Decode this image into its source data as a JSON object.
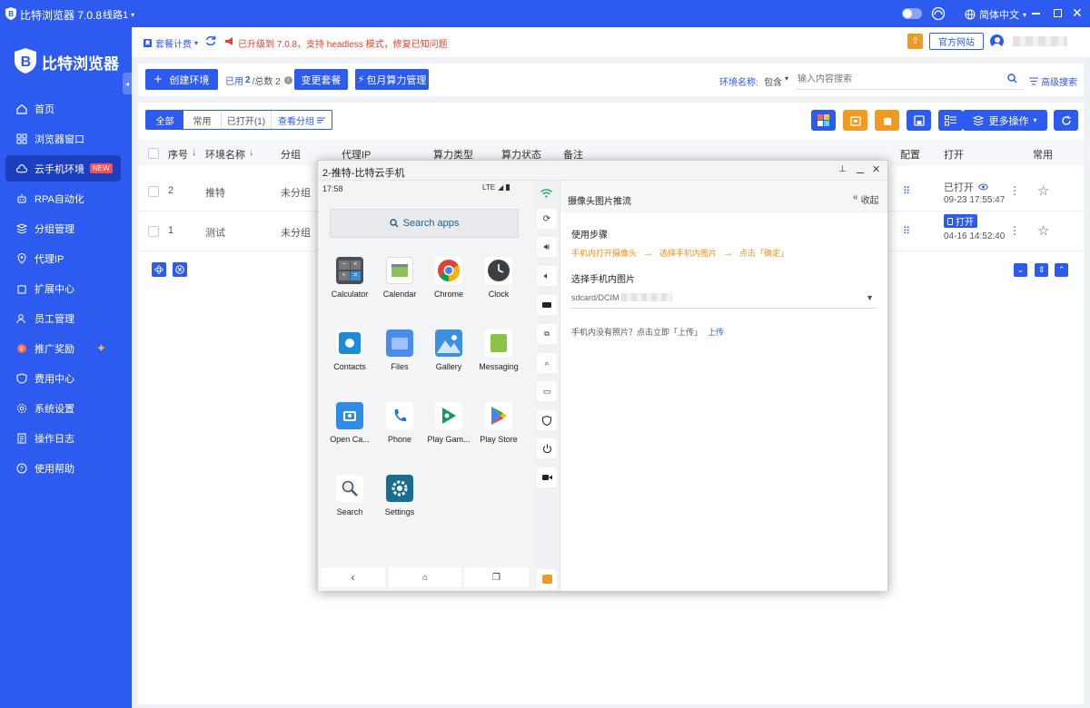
{
  "app": {
    "title": "比特浏览器 7.0.8",
    "route": "线路1",
    "language": "简体中文",
    "logo_text": "比特浏览器"
  },
  "sidebar": {
    "items": [
      {
        "label": "首页",
        "icon": "home-icon"
      },
      {
        "label": "浏览器窗口",
        "icon": "grid-icon"
      },
      {
        "label": "云手机环境",
        "icon": "cloud-icon",
        "badge": "NEW",
        "active": true
      },
      {
        "label": "RPA自动化",
        "icon": "robot-icon"
      },
      {
        "label": "分组管理",
        "icon": "group-icon"
      },
      {
        "label": "代理IP",
        "icon": "location-icon"
      },
      {
        "label": "扩展中心",
        "icon": "puzzle-icon"
      },
      {
        "label": "员工管理",
        "icon": "users-icon"
      },
      {
        "label": "推广奖励",
        "icon": "gift-icon"
      },
      {
        "label": "费用中心",
        "icon": "shield-icon"
      },
      {
        "label": "系统设置",
        "icon": "gear-icon"
      },
      {
        "label": "操作日志",
        "icon": "log-icon"
      },
      {
        "label": "使用帮助",
        "icon": "help-icon"
      }
    ]
  },
  "header": {
    "plan_label": "套餐计费",
    "notice": "已升级到 7.0.8，支持 headless 模式，修复已知问题",
    "website_button": "官方网站"
  },
  "toolbar": {
    "create_button": "创建环境",
    "usage_prefix": "已用",
    "usage_used": "2",
    "usage_total_label": "/总数 2",
    "change_plan_button": "变更套餐",
    "monthly_button": "包月算力管理",
    "env_name_label": "环境名称:",
    "match_select": "包含",
    "search_placeholder": "输入内容搜索",
    "advanced_search": "高级搜索"
  },
  "filters": {
    "tabs": [
      "全部",
      "常用",
      "已打开(1)",
      "查看分组"
    ],
    "more_ops": "更多操作"
  },
  "table": {
    "headers": [
      "序号",
      "环境名称",
      "分组",
      "代理IP",
      "算力类型",
      "算力状态",
      "备注",
      "配置",
      "打开",
      "常用"
    ],
    "rows": [
      {
        "index": "2",
        "name": "推特",
        "group": "未分组",
        "open_status": "已打开",
        "time": "09-23 17:55:47"
      },
      {
        "index": "1",
        "name": "测试",
        "group": "未分组",
        "open_button": "打开",
        "time": "04-16 14:52:40"
      }
    ]
  },
  "popup": {
    "title": "2-推特-比特云手机",
    "time": "17:58",
    "network": "LTE",
    "search_apps": "Search apps",
    "apps": [
      "Calculator",
      "Calendar",
      "Chrome",
      "Clock",
      "Contacts",
      "Files",
      "Gallery",
      "Messaging",
      "Open Ca...",
      "Phone",
      "Play Gam...",
      "Play Store",
      "Search",
      "Settings"
    ],
    "camera_panel": {
      "title": "摄像头图片推流",
      "collapse": "收起",
      "steps_label": "使用步骤",
      "steps": [
        "手机内打开摄像头",
        "选择手机内图片",
        "点击「确定」"
      ],
      "select_label": "选择手机内图片",
      "path_value": "sdcard/DCIM",
      "no_photo_text": "手机内没有照片？点击立即「上传」",
      "upload_link": "上传"
    }
  },
  "colors": {
    "brand": "#2d5bf0",
    "orange": "#f08c1a",
    "red_notice": "#e8402f"
  }
}
